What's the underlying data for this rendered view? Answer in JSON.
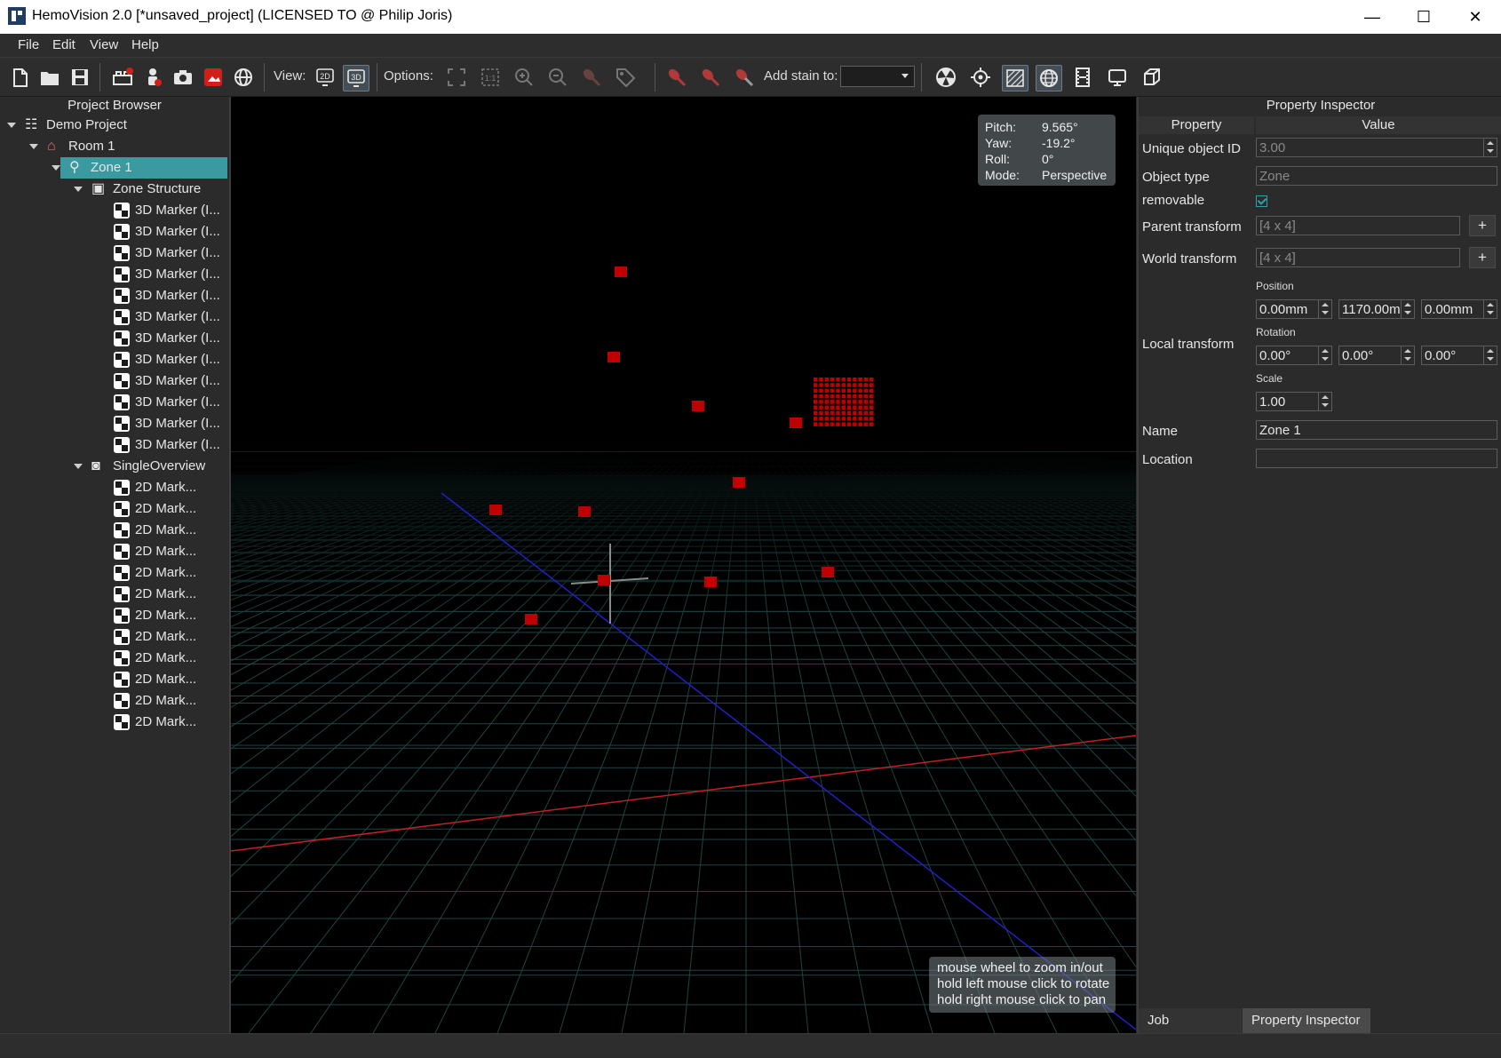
{
  "window": {
    "title": "HemoVision 2.0 [*unsaved_project] (LICENSED TO @ Philip Joris)",
    "minimize": "—",
    "maximize": "☐",
    "close": "✕"
  },
  "menu": [
    "File",
    "Edit",
    "View",
    "Help"
  ],
  "toolbar": {
    "view_label": "View:",
    "options_label": "Options:",
    "add_stain_label": "Add stain to:",
    "add_stain_value": "",
    "view_2d": "2D",
    "view_3d": "3D",
    "accent": "#3b9aa0"
  },
  "project_browser": {
    "title": "Project Browser",
    "items": [
      {
        "label": "Demo Project",
        "icon": "tree-hierarchy-icon"
      },
      {
        "label": "Room 1",
        "icon": "room-icon"
      },
      {
        "label": "Zone 1",
        "icon": "zone-pin-icon",
        "selected": true
      },
      {
        "label": "Zone Structure",
        "icon": "3d-structure-icon"
      },
      {
        "label": "3D Marker (I...",
        "icon": "marker-icon"
      },
      {
        "label": "3D Marker (I...",
        "icon": "marker-icon"
      },
      {
        "label": "3D Marker (I...",
        "icon": "marker-icon"
      },
      {
        "label": "3D Marker (I...",
        "icon": "marker-icon"
      },
      {
        "label": "3D Marker (I...",
        "icon": "marker-icon"
      },
      {
        "label": "3D Marker (I...",
        "icon": "marker-icon"
      },
      {
        "label": "3D Marker (I...",
        "icon": "marker-icon"
      },
      {
        "label": "3D Marker (I...",
        "icon": "marker-icon"
      },
      {
        "label": "3D Marker (I...",
        "icon": "marker-icon"
      },
      {
        "label": "3D Marker (I...",
        "icon": "marker-icon"
      },
      {
        "label": "3D Marker (I...",
        "icon": "marker-icon"
      },
      {
        "label": "3D Marker (I...",
        "icon": "marker-icon"
      },
      {
        "label": "SingleOverview",
        "icon": "camera-icon"
      },
      {
        "label": "2D Mark...",
        "icon": "marker-icon"
      },
      {
        "label": "2D Mark...",
        "icon": "marker-icon"
      },
      {
        "label": "2D Mark...",
        "icon": "marker-icon"
      },
      {
        "label": "2D Mark...",
        "icon": "marker-icon"
      },
      {
        "label": "2D Mark...",
        "icon": "marker-icon"
      },
      {
        "label": "2D Mark...",
        "icon": "marker-icon"
      },
      {
        "label": "2D Mark...",
        "icon": "marker-icon"
      },
      {
        "label": "2D Mark...",
        "icon": "marker-icon"
      },
      {
        "label": "2D Mark...",
        "icon": "marker-icon"
      },
      {
        "label": "2D Mark...",
        "icon": "marker-icon"
      },
      {
        "label": "2D Mark...",
        "icon": "marker-icon"
      },
      {
        "label": "2D Mark...",
        "icon": "marker-icon"
      }
    ]
  },
  "viewport": {
    "camera": {
      "pitch_label": "Pitch:",
      "pitch": "9.565°",
      "yaw_label": "Yaw:",
      "yaw": "-19.2°",
      "roll_label": "Roll:",
      "roll": "0°",
      "mode_label": "Mode:",
      "mode": "Perspective"
    },
    "hint": [
      "mouse wheel to zoom in/out",
      "hold left mouse click to rotate",
      "hold right mouse click to pan"
    ],
    "marker_color": "#c00000"
  },
  "inspector": {
    "title": "Property Inspector",
    "col_property": "Property",
    "col_value": "Value",
    "unique_id_label": "Unique object ID",
    "unique_id": "3.00",
    "object_type_label": "Object type",
    "object_type": "Zone",
    "removable_label": "removable",
    "parent_transform_label": "Parent transform",
    "parent_transform": "[4 x 4]",
    "world_transform_label": "World transform",
    "world_transform": "[4 x 4]",
    "plus": "+",
    "local_transform_label": "Local transform",
    "position_label": "Position",
    "position": [
      "0.00mm",
      "1170.00m",
      "0.00mm"
    ],
    "rotation_label": "Rotation",
    "rotation": [
      "0.00°",
      "0.00°",
      "0.00°"
    ],
    "scale_label": "Scale",
    "scale": "1.00",
    "name_label": "Name",
    "name": "Zone 1",
    "location_label": "Location",
    "location": ""
  },
  "tabs": [
    "Job Dispatcher",
    "Property Inspector"
  ]
}
